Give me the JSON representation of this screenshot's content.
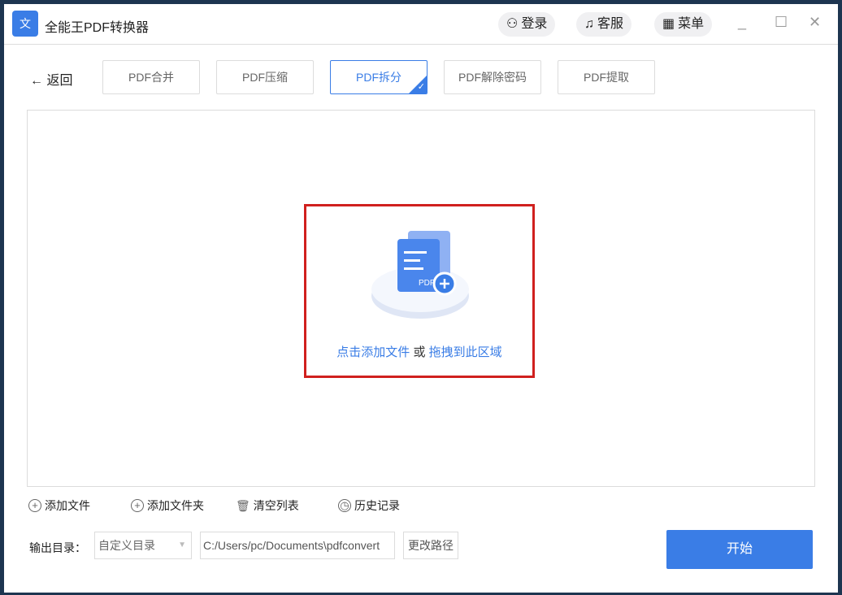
{
  "app": {
    "title": "全能王PDF转换器",
    "logo_text": "文"
  },
  "header": {
    "login": "登录",
    "service": "客服",
    "menu": "菜单"
  },
  "nav": {
    "back": "返回",
    "tabs": [
      {
        "label": "PDF合并"
      },
      {
        "label": "PDF压缩"
      },
      {
        "label": "PDF拆分",
        "active": true
      },
      {
        "label": "PDF解除密码"
      },
      {
        "label": "PDF提取"
      }
    ]
  },
  "drop": {
    "click_text": "点击添加文件",
    "or": "或",
    "drag_text": "拖拽到此区域",
    "pdf_label": "PDF"
  },
  "actions": {
    "add_file": "添加文件",
    "add_folder": "添加文件夹",
    "clear": "清空列表",
    "history": "历史记录"
  },
  "output": {
    "label": "输出目录：",
    "select_value": "自定义目录",
    "path": "C:/Users/pc/Documents\\pdfconvert",
    "change": "更改路径"
  },
  "start": "开始",
  "colors": {
    "accent": "#3a7de6",
    "highlight": "#d0201e"
  }
}
